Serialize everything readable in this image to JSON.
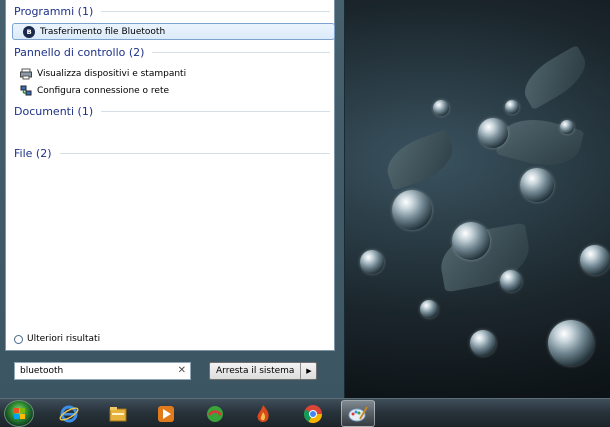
{
  "start_menu": {
    "groups": [
      {
        "title": "Programmi (1)"
      },
      {
        "title": "Pannello di controllo (2)"
      },
      {
        "title": "Documenti (1)"
      },
      {
        "title": "File (2)"
      }
    ],
    "programs": [
      {
        "label": "Trasferimento file Bluetooth",
        "icon": "bluetooth-icon"
      }
    ],
    "control_panel": [
      {
        "label": "Visualizza dispositivi e stampanti",
        "icon": "devices-printers-icon"
      },
      {
        "label": "Configura connessione o rete",
        "icon": "network-icon"
      }
    ],
    "more_results": "Ulteriori risultati",
    "search": {
      "value": "bluetooth"
    },
    "shutdown_label": "Arresta il sistema"
  },
  "taskbar": {
    "items": [
      {
        "name": "internet-explorer-icon",
        "color": "#1e6fd1"
      },
      {
        "name": "file-explorer-icon",
        "color": "#e8b33c"
      },
      {
        "name": "media-player-icon",
        "color": "#e07a1b"
      },
      {
        "name": "green-app-icon",
        "color": "#3aa33a"
      },
      {
        "name": "flame-app-icon",
        "color": "#d84a1c"
      },
      {
        "name": "chrome-icon",
        "color": "#db4437"
      },
      {
        "name": "paint-icon",
        "color": "#7fa7cf"
      }
    ]
  }
}
